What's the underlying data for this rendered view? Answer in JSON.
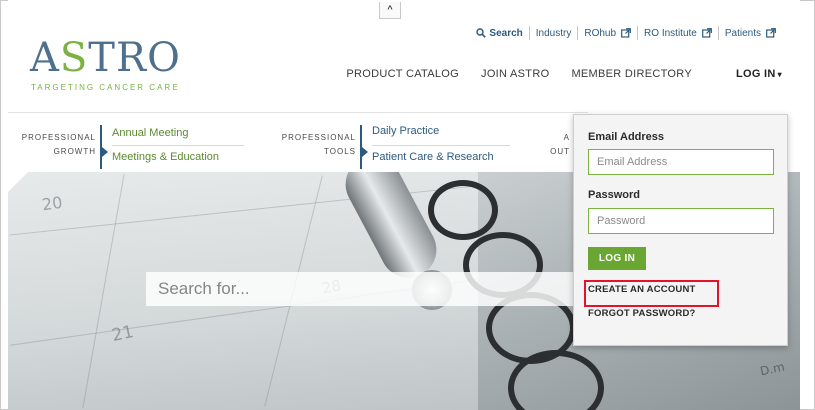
{
  "header": {
    "collapse_glyph": "^",
    "logo": {
      "wordmark_pre": "A",
      "wordmark_accent": "S",
      "wordmark_post": "TRO",
      "tagline": "TARGETING CANCER CARE"
    },
    "utility": {
      "search_label": "Search",
      "links": [
        {
          "label": "Industry",
          "external": false
        },
        {
          "label": "ROhub",
          "external": true
        },
        {
          "label": "RO Institute",
          "external": true
        },
        {
          "label": "Patients",
          "external": true
        }
      ]
    },
    "mainnav": {
      "items": [
        "PRODUCT CATALOG",
        "JOIN ASTRO",
        "MEMBER DIRECTORY"
      ],
      "login_label": "LOG IN",
      "login_caret": "▾"
    }
  },
  "subnav": {
    "groups": [
      {
        "label_line1": "PROFESSIONAL",
        "label_line2": "GROWTH",
        "link1": "Annual Meeting",
        "link2": "Meetings & Education"
      },
      {
        "label_line1": "PROFESSIONAL",
        "label_line2": "TOOLS",
        "link1": "Daily Practice",
        "link2": "Patient Care & Research"
      },
      {
        "label_line1": "A",
        "label_line2": "OUT"
      }
    ]
  },
  "hero": {
    "search_placeholder": "Search for...",
    "calendar_numbers": [
      "20",
      "28",
      "21"
    ],
    "corner_text": "D.m"
  },
  "login_panel": {
    "email_label": "Email Address",
    "email_placeholder": "Email Address",
    "password_label": "Password",
    "password_placeholder": "Password",
    "submit_label": "LOG IN",
    "create_account_label": "CREATE AN ACCOUNT",
    "forgot_password_label": "FORGOT PASSWORD?"
  },
  "colors": {
    "brand_blue": "#2c5a7e",
    "brand_green": "#7ab342",
    "button_green": "#6aa632",
    "highlight_red": "#e0142a"
  }
}
